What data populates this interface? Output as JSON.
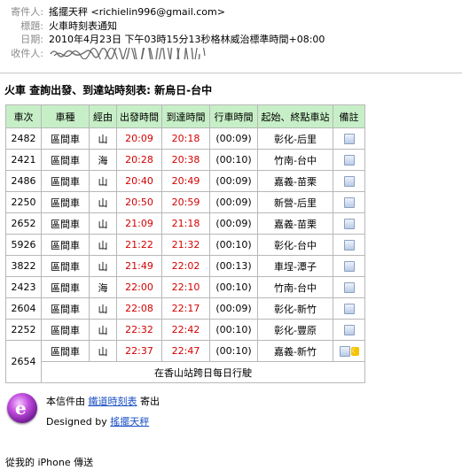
{
  "header": {
    "from_label": "寄件人:",
    "from_value": "搖擺天秤 <richielin996@gmail.com>",
    "subject_label": "標題:",
    "subject_value": "火車時刻表通知",
    "date_label": "日期:",
    "date_value": "2010年4月23日 下午03時15分13秒格林威治標準時間+08:00",
    "to_label": "收件人:"
  },
  "title": "火車 查詢出發、到達站時刻表: 新烏日-台中",
  "table": {
    "columns": [
      "車次",
      "車種",
      "經由",
      "出發時間",
      "到達時間",
      "行車時間",
      "起始、終點車站",
      "備註"
    ],
    "rows": [
      {
        "no": "2482",
        "kind": "區間車",
        "via": "山",
        "dep": "20:09",
        "arr": "20:18",
        "dur": "(00:09)",
        "route": "彰化-后里",
        "note": "note-icon"
      },
      {
        "no": "2421",
        "kind": "區間車",
        "via": "海",
        "dep": "20:28",
        "arr": "20:38",
        "dur": "(00:10)",
        "route": "竹南-台中",
        "note": "note-icon"
      },
      {
        "no": "2486",
        "kind": "區間車",
        "via": "山",
        "dep": "20:40",
        "arr": "20:49",
        "dur": "(00:09)",
        "route": "嘉義-苗栗",
        "note": "note-icon"
      },
      {
        "no": "2250",
        "kind": "區間車",
        "via": "山",
        "dep": "20:50",
        "arr": "20:59",
        "dur": "(00:09)",
        "route": "新營-后里",
        "note": "note-icon"
      },
      {
        "no": "2652",
        "kind": "區間車",
        "via": "山",
        "dep": "21:09",
        "arr": "21:18",
        "dur": "(00:09)",
        "route": "嘉義-苗栗",
        "note": "note-icon"
      },
      {
        "no": "5926",
        "kind": "區間車",
        "via": "山",
        "dep": "21:22",
        "arr": "21:32",
        "dur": "(00:10)",
        "route": "彰化-台中",
        "note": "note-icon"
      },
      {
        "no": "3822",
        "kind": "區間車",
        "via": "山",
        "dep": "21:49",
        "arr": "22:02",
        "dur": "(00:13)",
        "route": "車埕-潭子",
        "note": "note-icon"
      },
      {
        "no": "2423",
        "kind": "區間車",
        "via": "海",
        "dep": "22:00",
        "arr": "22:10",
        "dur": "(00:10)",
        "route": "竹南-台中",
        "note": "note-icon"
      },
      {
        "no": "2604",
        "kind": "區間車",
        "via": "山",
        "dep": "22:08",
        "arr": "22:17",
        "dur": "(00:09)",
        "route": "彰化-新竹",
        "note": "note-icon"
      },
      {
        "no": "2252",
        "kind": "區間車",
        "via": "山",
        "dep": "22:32",
        "arr": "22:42",
        "dur": "(00:10)",
        "route": "彰化-豐原",
        "note": "note-icon"
      }
    ],
    "last_row": {
      "no": "2654",
      "kind": "區間車",
      "via": "山",
      "dep": "22:37",
      "arr": "22:47",
      "dur": "(00:10)",
      "route": "嘉義-新竹",
      "note": "note-icon, moon-icon",
      "footnote": "在香山站跨日每日行駛"
    }
  },
  "promo": {
    "line1_prefix": "本信件由",
    "link1": "鐵道時刻表",
    "line1_suffix": "寄出",
    "line2_prefix": "Designed by",
    "link2": "搖擺天秤"
  },
  "signature": "從我的 iPhone 傳送",
  "colors": {
    "header_bg": "#c7efc7",
    "time_red": "#d40000",
    "link_blue": "#1a4fc4"
  }
}
